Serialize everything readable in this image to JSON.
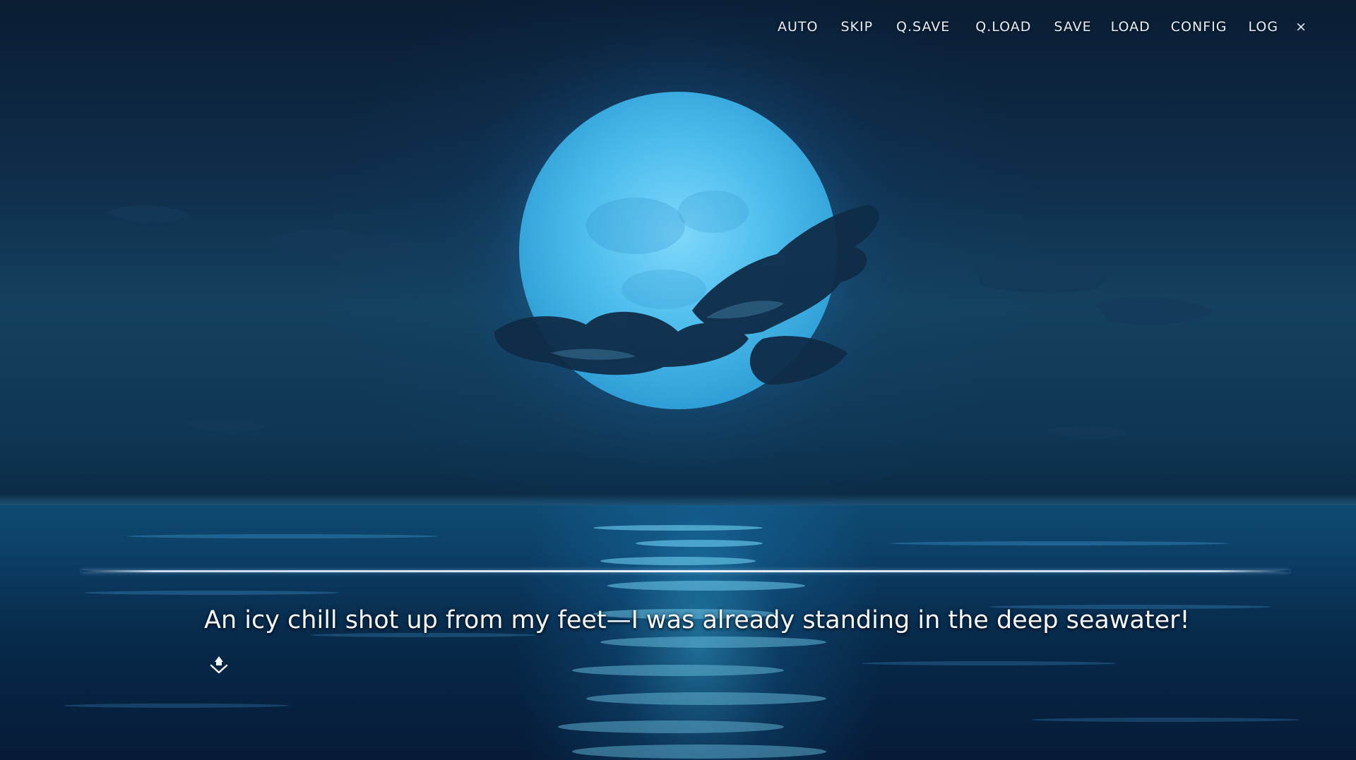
{
  "menu": {
    "items": [
      {
        "id": "auto",
        "label": "AUTO"
      },
      {
        "id": "skip",
        "label": "SKIP"
      },
      {
        "id": "qsave",
        "label": "Q.SAVE"
      },
      {
        "id": "qload",
        "label": "Q.LOAD"
      },
      {
        "id": "save",
        "label": "SAVE"
      },
      {
        "id": "load",
        "label": "LOAD"
      },
      {
        "id": "config",
        "label": "CONFIG"
      },
      {
        "id": "log",
        "label": "LOG"
      }
    ],
    "close_label": "×"
  },
  "dialogue": {
    "text": "An icy chill shot up from my feet—I was already standing in the deep seawater!"
  },
  "icons": {
    "next": "next-page-arrow-icon"
  },
  "colors": {
    "moon": "#4fc3f0",
    "sky_dark": "#0a1d33",
    "sea_glow": "#3cc8ff",
    "text": "#f4f7fb"
  }
}
